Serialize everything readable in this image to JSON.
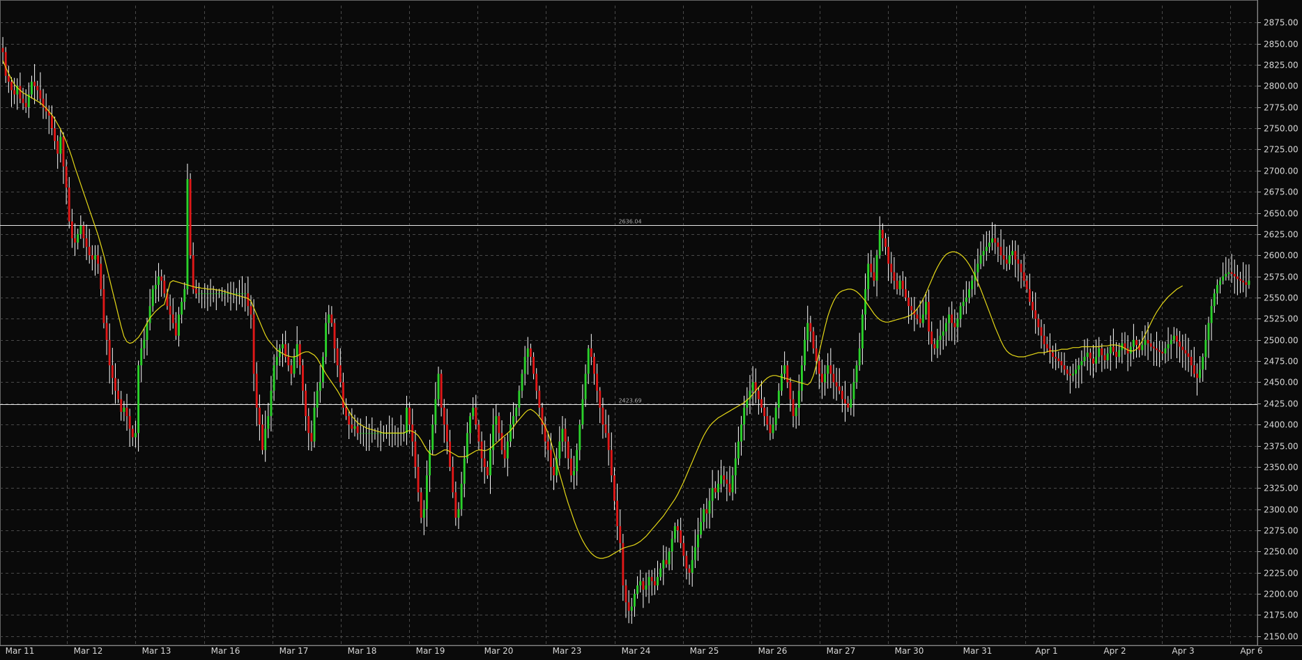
{
  "chart_data": {
    "type": "candlestick",
    "title": "",
    "xlabel": "",
    "ylabel": "",
    "ylim": [
      2140,
      2895
    ],
    "y_ticks": [
      2150,
      2175,
      2200,
      2225,
      2250,
      2275,
      2300,
      2325,
      2350,
      2375,
      2400,
      2425,
      2450,
      2475,
      2500,
      2525,
      2550,
      2575,
      2600,
      2625,
      2650,
      2675,
      2700,
      2725,
      2750,
      2775,
      2800,
      2825,
      2850,
      2875
    ],
    "y_tick_labels": [
      "2150.00",
      "2175.00",
      "2200.00",
      "2225.00",
      "2250.00",
      "2275.00",
      "2300.00",
      "2325.00",
      "2350.00",
      "2375.00",
      "2400.00",
      "2425.00",
      "2450.00",
      "2475.00",
      "2500.00",
      "2525.00",
      "2550.00",
      "2575.00",
      "2600.00",
      "2625.00",
      "2650.00",
      "2675.00",
      "2700.00",
      "2725.00",
      "2750.00",
      "2775.00",
      "2800.00",
      "2825.00",
      "2850.00",
      "2875.00"
    ],
    "x_labels": [
      "Mar 11",
      "Mar 12",
      "Mar 13",
      "Mar 16",
      "Mar 17",
      "Mar 18",
      "Mar 19",
      "Mar 20",
      "Mar 23",
      "Mar 24",
      "Mar 25",
      "Mar 26",
      "Mar 27",
      "Mar 30",
      "Mar 31",
      "Apr 1",
      "Apr 2",
      "Apr 3",
      "Apr 6"
    ],
    "bars_per_session": 20,
    "grid": true,
    "horizontal_lines": [
      {
        "value": 2636.04,
        "label": "2636.04"
      },
      {
        "value": 2423.69,
        "label": "2423.69"
      }
    ],
    "series_close": [
      2840,
      2812,
      2805,
      2795,
      2790,
      2800,
      2785,
      2780,
      2775,
      2790,
      2805,
      2800,
      2795,
      2785,
      2775,
      2770,
      2765,
      2750,
      2735,
      2720,
      2740,
      2705,
      2680,
      2640,
      2620,
      2615,
      2625,
      2635,
      2620,
      2610,
      2600,
      2595,
      2600,
      2590,
      2560,
      2520,
      2500,
      2470,
      2455,
      2440,
      2430,
      2415,
      2420,
      2410,
      2395,
      2385,
      2390,
      2470,
      2490,
      2500,
      2520,
      2540,
      2560,
      2565,
      2575,
      2570,
      2555,
      2540,
      2530,
      2520,
      2505,
      2530,
      2545,
      2560,
      2690,
      2600,
      2560,
      2555,
      2555,
      2555,
      2555,
      2555,
      2555,
      2555,
      2555,
      2555,
      2555,
      2555,
      2555,
      2555,
      2555,
      2555,
      2555,
      2555,
      2555,
      2540,
      2530,
      2460,
      2420,
      2400,
      2370,
      2395,
      2410,
      2440,
      2470,
      2480,
      2490,
      2495,
      2480,
      2470,
      2460,
      2480,
      2495,
      2470,
      2440,
      2410,
      2390,
      2380,
      2420,
      2440,
      2450,
      2480,
      2520,
      2530,
      2520,
      2490,
      2470,
      2450,
      2420,
      2410,
      2400,
      2395,
      2398,
      2390,
      2390,
      2390,
      2390,
      2390,
      2390,
      2390,
      2390,
      2390,
      2390,
      2390,
      2390,
      2390,
      2390,
      2390,
      2390,
      2390,
      2420,
      2400,
      2380,
      2350,
      2320,
      2290,
      2300,
      2340,
      2370,
      2400,
      2430,
      2460,
      2420,
      2400,
      2380,
      2350,
      2320,
      2290,
      2300,
      2330,
      2360,
      2390,
      2410,
      2420,
      2400,
      2380,
      2360,
      2350,
      2340,
      2370,
      2400,
      2410,
      2390,
      2370,
      2360,
      2380,
      2400,
      2410,
      2420,
      2440,
      2460,
      2480,
      2490,
      2480,
      2460,
      2440,
      2420,
      2400,
      2380,
      2370,
      2350,
      2340,
      2360,
      2380,
      2395,
      2380,
      2360,
      2340,
      2345,
      2370,
      2400,
      2430,
      2460,
      2490,
      2480,
      2460,
      2440,
      2420,
      2400,
      2390,
      2370,
      2340,
      2310,
      2280,
      2260,
      2210,
      2190,
      2180,
      2185,
      2200,
      2210,
      2215,
      2205,
      2210,
      2220,
      2215,
      2210,
      2220,
      2230,
      2240,
      2235,
      2250,
      2265,
      2280,
      2275,
      2260,
      2245,
      2230,
      2225,
      2240,
      2255,
      2270,
      2285,
      2300,
      2295,
      2310,
      2325,
      2320,
      2330,
      2340,
      2335,
      2330,
      2320,
      2340,
      2360,
      2380,
      2400,
      2420,
      2430,
      2440,
      2450,
      2440,
      2430,
      2420,
      2410,
      2400,
      2390,
      2400,
      2420,
      2440,
      2460,
      2470,
      2450,
      2430,
      2410,
      2420,
      2440,
      2470,
      2500,
      2520,
      2510,
      2490,
      2475,
      2460,
      2450,
      2460,
      2470,
      2460,
      2450,
      2445,
      2440,
      2430,
      2425,
      2420,
      2430,
      2450,
      2470,
      2490,
      2530,
      2560,
      2590,
      2580,
      2570,
      2600,
      2630,
      2620,
      2610,
      2590,
      2580,
      2570,
      2560,
      2570,
      2560,
      2550,
      2540,
      2535,
      2530,
      2525,
      2520,
      2530,
      2545,
      2510,
      2495,
      2490,
      2500,
      2505,
      2510,
      2520,
      2530,
      2520,
      2515,
      2525,
      2540,
      2545,
      2550,
      2560,
      2570,
      2580,
      2590,
      2600,
      2605,
      2610,
      2615,
      2620,
      2615,
      2610,
      2600,
      2595,
      2590,
      2600,
      2605,
      2595,
      2590,
      2580,
      2570,
      2560,
      2545,
      2535,
      2525,
      2515,
      2505,
      2495,
      2490,
      2485,
      2480,
      2478,
      2475,
      2470,
      2465,
      2460,
      2458,
      2460,
      2465,
      2470,
      2475,
      2480,
      2485,
      2478,
      2472,
      2480,
      2490,
      2482,
      2476,
      2484,
      2492,
      2486,
      2480,
      2488,
      2496,
      2490,
      2484,
      2492,
      2500,
      2494,
      2488,
      2494,
      2500,
      2496,
      2492,
      2490,
      2488,
      2486,
      2484,
      2490,
      2495,
      2500,
      2505,
      2498,
      2492,
      2488,
      2484,
      2480,
      2470,
      2460,
      2455,
      2465,
      2480,
      2500,
      2520,
      2540,
      2555,
      2565,
      2570,
      2575,
      2578,
      2580,
      2578,
      2575,
      2572,
      2570,
      2568,
      2565,
      2570
    ],
    "series_ma": [
      2830,
      2822,
      2815,
      2808,
      2802,
      2798,
      2795,
      2792,
      2790,
      2788,
      2786,
      2784,
      2782,
      2780,
      2777,
      2774,
      2770,
      2766,
      2761,
      2755,
      2749,
      2742,
      2734,
      2725,
      2715,
      2704,
      2694,
      2684,
      2674,
      2664,
      2654,
      2644,
      2634,
      2624,
      2612,
      2600,
      2586,
      2572,
      2558,
      2544,
      2530,
      2516,
      2504,
      2498,
      2496,
      2497,
      2500,
      2503,
      2508,
      2514,
      2520,
      2526,
      2530,
      2534,
      2537,
      2540,
      2542,
      2555,
      2568,
      2570,
      2569,
      2568,
      2567,
      2566,
      2565,
      2564,
      2563,
      2562,
      2562,
      2561,
      2561,
      2560,
      2560,
      2560,
      2559,
      2559,
      2558,
      2557,
      2556,
      2555,
      2554,
      2553,
      2552,
      2551,
      2550,
      2549,
      2546,
      2538,
      2530,
      2522,
      2514,
      2506,
      2500,
      2496,
      2492,
      2488,
      2486,
      2484,
      2482,
      2481,
      2480,
      2480,
      2481,
      2483,
      2485,
      2486,
      2486,
      2484,
      2482,
      2478,
      2472,
      2466,
      2460,
      2455,
      2450,
      2445,
      2440,
      2434,
      2428,
      2422,
      2416,
      2410,
      2406,
      2402,
      2400,
      2398,
      2396,
      2395,
      2394,
      2393,
      2392,
      2391,
      2390,
      2390,
      2390,
      2390,
      2390,
      2390,
      2390,
      2390,
      2392,
      2393,
      2392,
      2390,
      2387,
      2382,
      2376,
      2370,
      2366,
      2364,
      2364,
      2366,
      2368,
      2370,
      2370,
      2368,
      2366,
      2364,
      2362,
      2362,
      2362,
      2363,
      2365,
      2367,
      2369,
      2370,
      2370,
      2369,
      2370,
      2372,
      2375,
      2378,
      2381,
      2384,
      2387,
      2390,
      2393,
      2397,
      2402,
      2406,
      2410,
      2414,
      2417,
      2418,
      2416,
      2413,
      2409,
      2404,
      2398,
      2390,
      2380,
      2368,
      2355,
      2342,
      2330,
      2318,
      2307,
      2297,
      2287,
      2278,
      2270,
      2263,
      2257,
      2252,
      2248,
      2245,
      2243,
      2242,
      2242,
      2243,
      2244,
      2246,
      2248,
      2250,
      2252,
      2254,
      2255,
      2256,
      2257,
      2258,
      2260,
      2262,
      2265,
      2268,
      2272,
      2276,
      2280,
      2284,
      2288,
      2292,
      2297,
      2302,
      2307,
      2312,
      2318,
      2325,
      2332,
      2340,
      2348,
      2356,
      2364,
      2372,
      2380,
      2387,
      2393,
      2398,
      2402,
      2405,
      2408,
      2410,
      2412,
      2414,
      2416,
      2418,
      2420,
      2422,
      2424,
      2426,
      2429,
      2432,
      2436,
      2440,
      2444,
      2448,
      2452,
      2455,
      2457,
      2458,
      2458,
      2457,
      2456,
      2455,
      2454,
      2453,
      2452,
      2451,
      2450,
      2449,
      2448,
      2447,
      2450,
      2458,
      2470,
      2485,
      2500,
      2515,
      2528,
      2538,
      2546,
      2552,
      2556,
      2558,
      2559,
      2560,
      2560,
      2559,
      2557,
      2554,
      2550,
      2546,
      2541,
      2536,
      2531,
      2527,
      2524,
      2522,
      2521,
      2521,
      2522,
      2523,
      2524,
      2525,
      2526,
      2527,
      2528,
      2530,
      2533,
      2537,
      2542,
      2548,
      2555,
      2563,
      2571,
      2579,
      2586,
      2592,
      2597,
      2601,
      2603,
      2604,
      2604,
      2603,
      2601,
      2598,
      2594,
      2589,
      2583,
      2576,
      2568,
      2560,
      2551,
      2542,
      2533,
      2524,
      2515,
      2507,
      2499,
      2492,
      2487,
      2484,
      2482,
      2481,
      2480,
      2480,
      2480,
      2481,
      2482,
      2483,
      2484,
      2485,
      2485,
      2485,
      2486,
      2487,
      2487,
      2487,
      2488,
      2489,
      2489,
      2489,
      2490,
      2491,
      2491,
      2491,
      2492,
      2492,
      2492,
      2492,
      2492,
      2492,
      2492,
      2493,
      2493,
      2493,
      2494,
      2494,
      2494,
      2493,
      2492,
      2490,
      2488,
      2487,
      2487,
      2489,
      2493,
      2499,
      2506,
      2513,
      2520,
      2527,
      2533,
      2538,
      2543,
      2547,
      2551,
      2554,
      2557,
      2560,
      2562,
      2564
    ]
  },
  "colors": {
    "background": "#0a0a0a",
    "grid": "#4a4a4a",
    "axis_text": "#d8d8d8",
    "up_candle": "#2bd12b",
    "down_candle": "#e01818",
    "wick": "#ffffff",
    "moving_average": "#e5d817",
    "horizontal_line": "#e8e8e8"
  }
}
